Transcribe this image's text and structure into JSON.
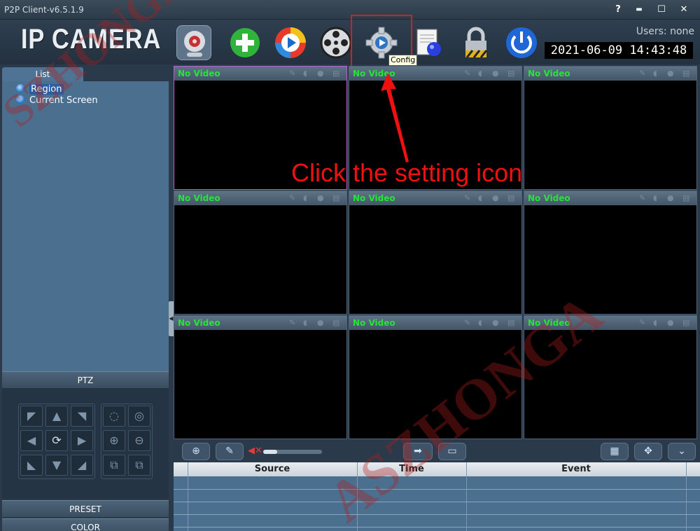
{
  "window": {
    "title": "P2P Client-v6.5.1.9",
    "help_label": "?",
    "minimize_label": "▬",
    "maximize_label": "☐",
    "close_label": "✕"
  },
  "header": {
    "logo": "IP CAMERA",
    "users": "Users: none",
    "datetime": "2021-06-09 14:43:48",
    "toolbar": [
      {
        "icon": "webcam-icon",
        "selected": true
      },
      {
        "icon": "add-icon"
      },
      {
        "icon": "playback-icon"
      },
      {
        "icon": "film-reel-icon"
      },
      {
        "icon": "gear-icon",
        "tooltip": "Config"
      },
      {
        "icon": "log-document-icon"
      },
      {
        "icon": "padlock-icon"
      },
      {
        "icon": "power-icon"
      }
    ]
  },
  "sidebar": {
    "tab_label": "List",
    "tree": [
      {
        "label": "Region",
        "selected": true
      },
      {
        "label": "Current Screen"
      }
    ],
    "ptz_label": "PTZ",
    "preset_label": "PRESET",
    "color_label": "COLOR"
  },
  "video_grid": {
    "cells": [
      {
        "label": "No Video",
        "active": true
      },
      {
        "label": "No Video"
      },
      {
        "label": "No Video"
      },
      {
        "label": "No Video"
      },
      {
        "label": "No Video"
      },
      {
        "label": "No Video"
      },
      {
        "label": "No Video"
      },
      {
        "label": "No Video"
      },
      {
        "label": "No Video"
      }
    ]
  },
  "events_table": {
    "columns": [
      "Source",
      "Time",
      "Event"
    ],
    "rows": []
  },
  "annotation": {
    "text": "Click the setting icon",
    "color": "#f01010"
  },
  "watermarks": [
    "SZHONGA",
    "ASZHONGA"
  ]
}
